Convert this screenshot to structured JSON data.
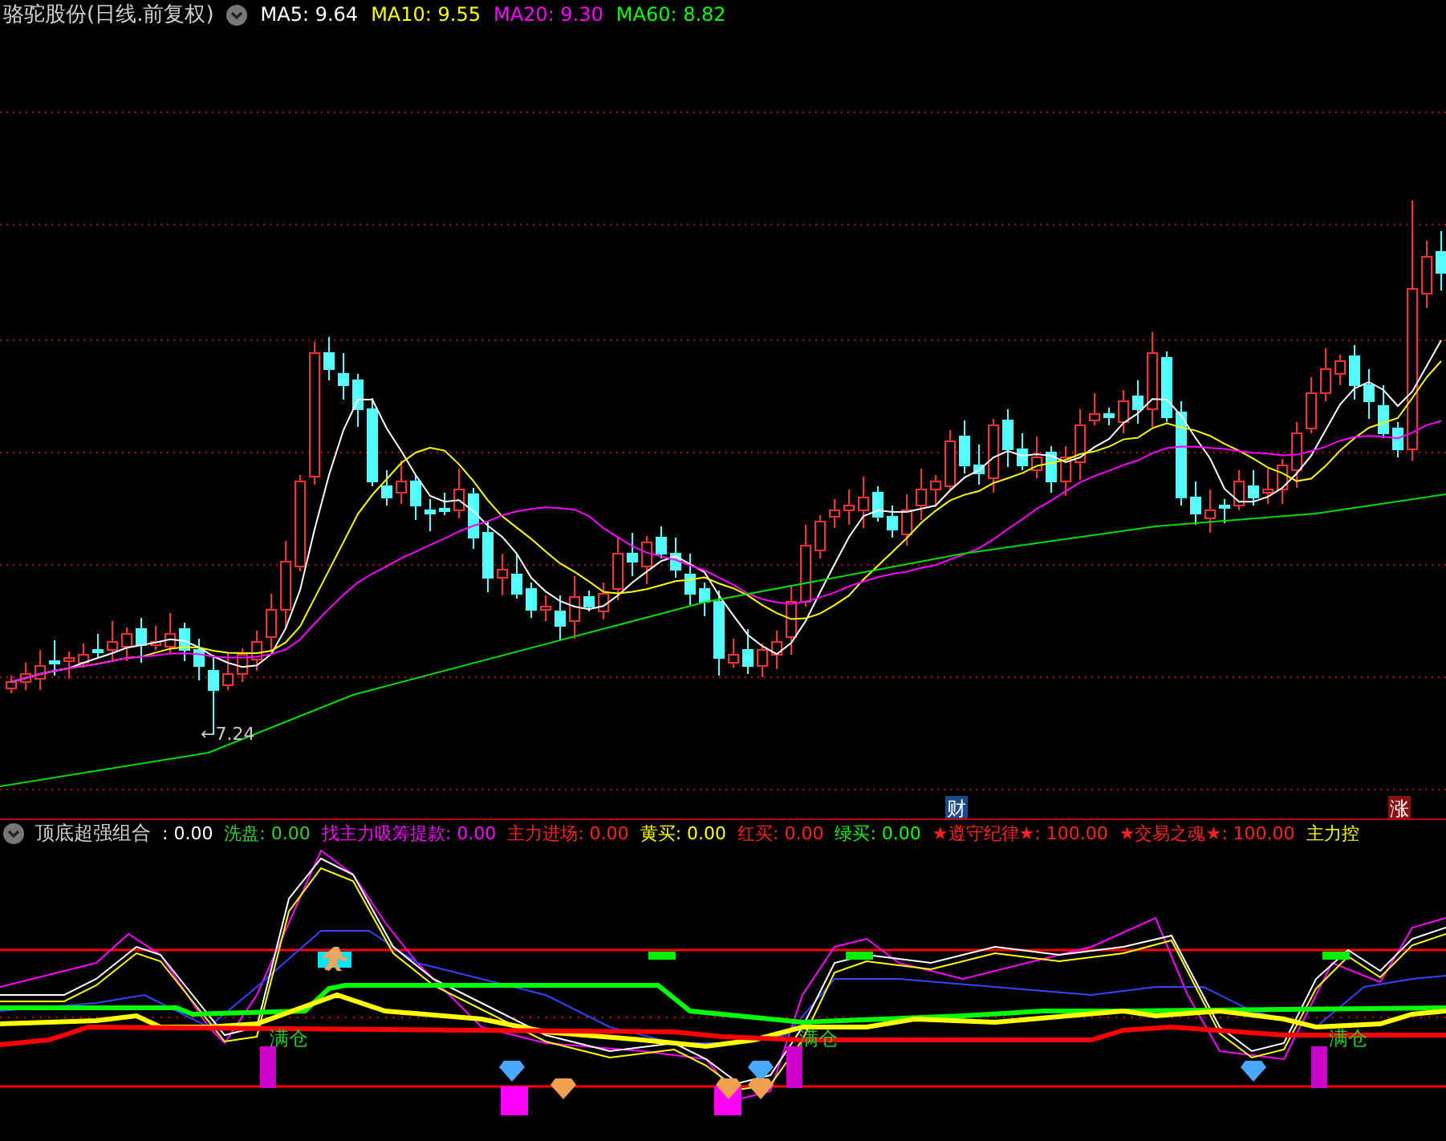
{
  "main_panel": {
    "title": "骆驼股份(日线.前复权)",
    "ma_legend": [
      {
        "label": "MA5: 9.64",
        "color": "#ffffff"
      },
      {
        "label": "MA10: 9.55",
        "color": "#ffff00"
      },
      {
        "label": "MA20: 9.30",
        "color": "#ff00ff"
      },
      {
        "label": "MA60: 8.82",
        "color": "#00ff00"
      }
    ],
    "low_marker": "←7.24",
    "event_badges": [
      {
        "text": "财",
        "color": "#1a4a8a"
      },
      {
        "text": "涨",
        "color": "#8a1010"
      }
    ]
  },
  "indicator_panel": {
    "title": "顶底超强组合",
    "values": [
      {
        "label": ": 0.00",
        "color": "#ffffff"
      },
      {
        "label": "洗盘: 0.00",
        "color": "#33cc33"
      },
      {
        "label": "找主力吸筹提款: 0.00",
        "color": "#ff00ff"
      },
      {
        "label": "主力进场: 0.00",
        "color": "#ff2020"
      },
      {
        "label": "黄买: 0.00",
        "color": "#ffff00"
      },
      {
        "label": "红买: 0.00",
        "color": "#ff2020"
      },
      {
        "label": "绿买: 0.00",
        "color": "#00ff00"
      },
      {
        "label": "★遵守纪律★: 100.00",
        "color": "#ff2020"
      },
      {
        "label": "★交易之魂★: 100.00",
        "color": "#ff2020"
      },
      {
        "label": "主力控",
        "color": "#ffff00"
      }
    ],
    "markers": [
      {
        "text": "满仓"
      },
      {
        "text": "满仓"
      },
      {
        "text": "满仓"
      }
    ]
  }
}
